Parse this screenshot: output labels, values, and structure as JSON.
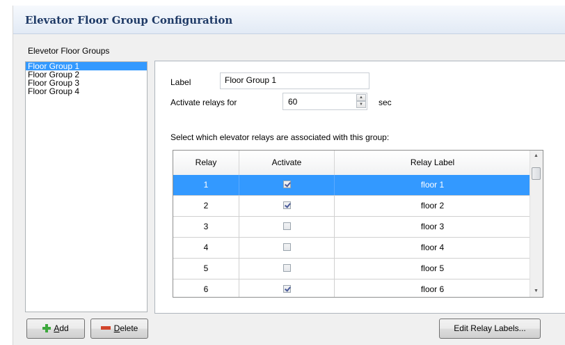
{
  "header": {
    "title": "Elevator Floor Group Configuration"
  },
  "groups": {
    "caption": "Elevetor Floor Groups",
    "items": [
      {
        "label": "Floor Group 1",
        "selected": true
      },
      {
        "label": "Floor Group 2",
        "selected": false
      },
      {
        "label": "Floor Group 3",
        "selected": false
      },
      {
        "label": "Floor Group 4",
        "selected": false
      }
    ]
  },
  "detail": {
    "label_caption": "Label",
    "label_value": "Floor Group 1",
    "activate_caption": "Activate relays for",
    "activate_value": "60",
    "activate_unit": "sec",
    "select_instruction": "Select which elevator relays are associated with this group:"
  },
  "relay_table": {
    "headers": {
      "relay": "Relay",
      "activate": "Activate",
      "label": "Relay Label"
    },
    "rows": [
      {
        "relay": "1",
        "activate": true,
        "label": "floor 1",
        "selected": true
      },
      {
        "relay": "2",
        "activate": true,
        "label": "floor 2",
        "selected": false
      },
      {
        "relay": "3",
        "activate": false,
        "label": "floor 3",
        "selected": false
      },
      {
        "relay": "4",
        "activate": false,
        "label": "floor 4",
        "selected": false
      },
      {
        "relay": "5",
        "activate": false,
        "label": "floor 5",
        "selected": false
      },
      {
        "relay": "6",
        "activate": true,
        "label": "floor 6",
        "selected": false
      }
    ]
  },
  "buttons": {
    "add": {
      "mnemonic": "A",
      "rest": "dd"
    },
    "delete": {
      "mnemonic": "D",
      "rest": "elete"
    },
    "edit_labels": "Edit Relay Labels..."
  },
  "colors": {
    "selection": "#3399ff",
    "title": "#1f3a66",
    "add_icon": "#3da83d",
    "delete_icon": "#d2452b"
  },
  "icons": {
    "add": "plus-icon",
    "delete": "minus-icon",
    "spin_up": "spin-up-icon",
    "spin_down": "spin-down-icon"
  }
}
